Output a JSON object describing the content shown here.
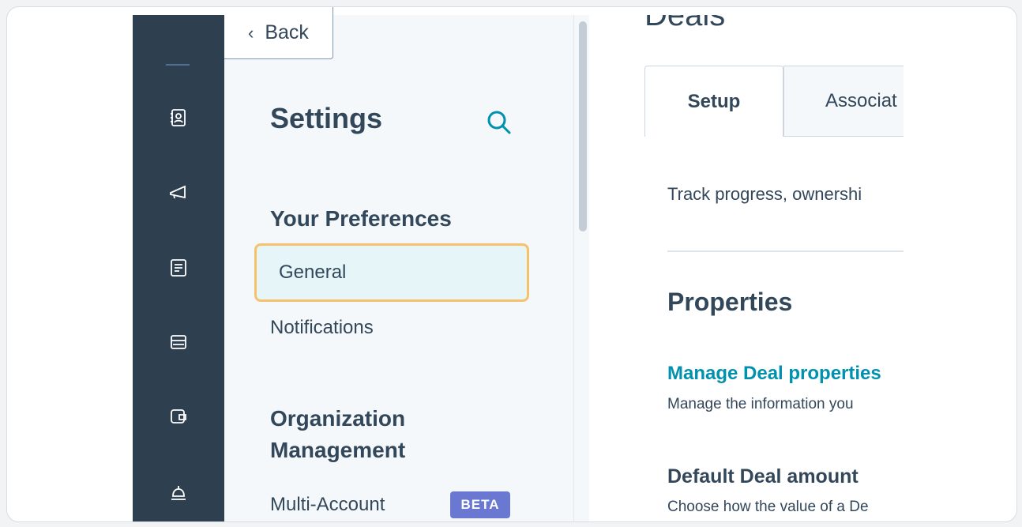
{
  "nav": {
    "icons": [
      "contacts-icon",
      "marketing-megaphone-icon",
      "content-icon",
      "commerce-icon",
      "service-wallet-icon",
      "service-bell-icon"
    ]
  },
  "settings": {
    "back_label": "Back",
    "title": "Settings",
    "your_preferences": "Your Preferences",
    "items": [
      {
        "label": "General"
      },
      {
        "label": "Notifications"
      }
    ],
    "org_heading_line1": "Organization",
    "org_heading_line2": "Management",
    "multi_account": "Multi-Account",
    "beta": "BETA"
  },
  "content": {
    "page_title": "Deals",
    "tabs": [
      {
        "label": "Setup"
      },
      {
        "label": "Associat"
      }
    ],
    "description": "Track progress, ownershi",
    "properties_heading": "Properties",
    "manage_link": "Manage Deal properties",
    "manage_sub": "Manage the information you",
    "default_heading": "Default Deal amount",
    "default_sub": "Choose how the value of a De"
  },
  "colors": {
    "nav_bg": "#2e3f50",
    "panel_bg": "#f5f8fa",
    "active_bg": "#e5f5f8",
    "focus_outline": "#f5c26b",
    "link": "#0091ae",
    "beta": "#6a78d1"
  }
}
